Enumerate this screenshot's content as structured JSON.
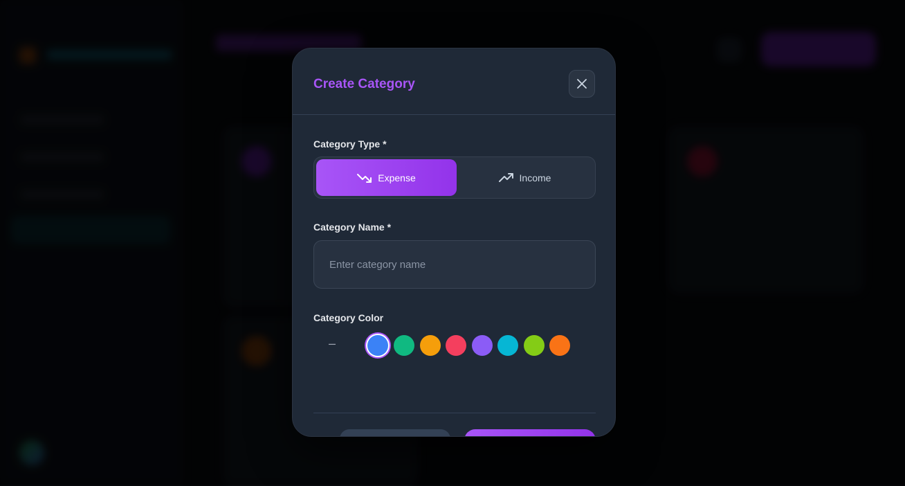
{
  "modal": {
    "title": "Create Category",
    "close_icon": "close-icon",
    "category_type": {
      "label": "Category Type *",
      "options": [
        {
          "label": "Expense",
          "icon": "trending-down-icon",
          "selected": true
        },
        {
          "label": "Income",
          "icon": "trending-up-icon",
          "selected": false
        }
      ]
    },
    "category_name": {
      "label": "Category Name *",
      "value": "",
      "placeholder": "Enter category name"
    },
    "category_color": {
      "label": "Category Color",
      "prefix": "–",
      "swatches": [
        "#3b82f6",
        "#10b981",
        "#f59e0b",
        "#f43f5e",
        "#8b5cf6",
        "#06b6d4",
        "#84cc16",
        "#f97316"
      ],
      "selected": "#3b82f6"
    }
  },
  "colors": {
    "accent": "#a855f7",
    "modal_bg": "#1f2937"
  }
}
